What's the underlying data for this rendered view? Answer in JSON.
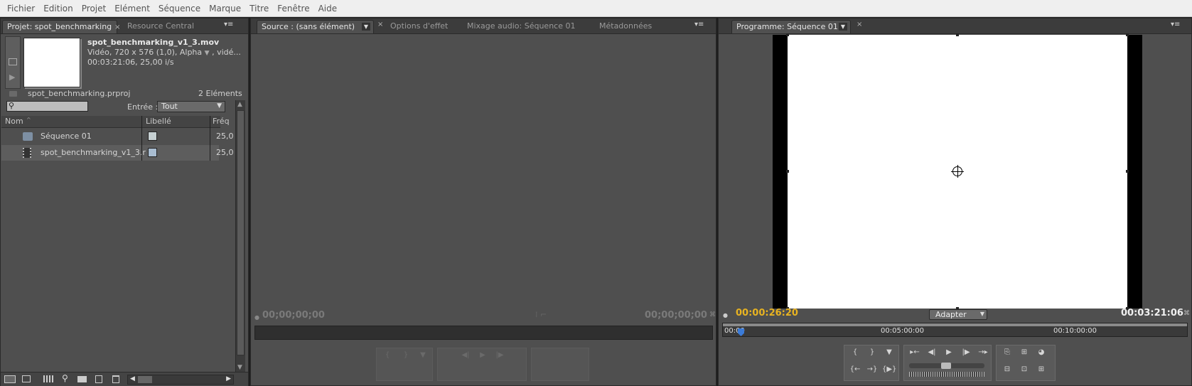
{
  "menubar": [
    "Fichier",
    "Edition",
    "Projet",
    "Elément",
    "Séquence",
    "Marque",
    "Titre",
    "Fenêtre",
    "Aide"
  ],
  "project_panel": {
    "tab_active": "Projet: spot_benchmarking",
    "tab_other": "Resource Central",
    "close": "×",
    "menu_glyph": "▾≡",
    "clip_name": "spot_benchmarking_v1_3.mov",
    "clip_info1_a": "Vidéo, 720 x 576 (1,0), Alpha",
    "clip_info1_b": ", vidé...",
    "clip_info2": "00:03:21:06, 25,00 i/s",
    "project_file": "spot_benchmarking.prproj",
    "item_count": "2 Eléments",
    "entree_label": "Entrée :",
    "entree_value": "Tout",
    "columns": {
      "name": "Nom",
      "label": "Libellé",
      "freq": "Fréq"
    },
    "items": [
      {
        "name": "Séquence 01",
        "freq": "25,0",
        "color": "#c6d0d2"
      },
      {
        "name": "spot_benchmarking_v1_3.r",
        "freq": "25,0",
        "color": "#a9bdd1"
      }
    ]
  },
  "source_panel": {
    "tab_active": "Source : (sans élément)",
    "tabs": [
      "Options d'effet",
      "Mixage audio: Séquence 01",
      "Métadonnées"
    ],
    "tc_left": "00;00;00;00",
    "tc_right": "00;00;00;00"
  },
  "program_panel": {
    "tab_active": "Programme: Séquence 01",
    "tc_current": "00:00:26:20",
    "tc_duration": "00:03:21:06",
    "fit_label": "Adapter",
    "ruler": [
      "00:00",
      "00:05:00:00",
      "00:10:00:00"
    ],
    "playhead_fraction": 0.01,
    "accent": "#e8b321"
  },
  "icons": {
    "search": "⚲",
    "play": "▶",
    "step_back": "◀|",
    "step_fwd": "|▶",
    "mark_in": "{",
    "mark_out": "}",
    "marker": "▼"
  }
}
